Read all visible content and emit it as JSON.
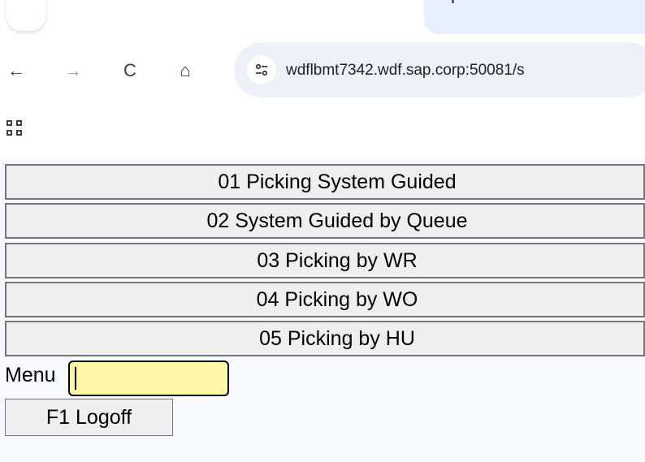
{
  "browser": {
    "url": "wdflbmt7342.wdf.sap.corp:50081/s",
    "back_icon": "←",
    "forward_icon": "→",
    "reload_icon": "C",
    "home_icon": "⌂",
    "site_info_icon": "tune-icon"
  },
  "menu": {
    "items": [
      {
        "label": "01 Picking System Guided"
      },
      {
        "label": "02 System Guided by Queue"
      },
      {
        "label": "03 Picking by WR"
      },
      {
        "label": "04 Picking by WO"
      },
      {
        "label": "05 Picking by HU"
      }
    ],
    "input_label": "Menu",
    "input_value": "",
    "input_highlight_color": "#fff6a6",
    "logoff_label": "F1 Logoff"
  }
}
